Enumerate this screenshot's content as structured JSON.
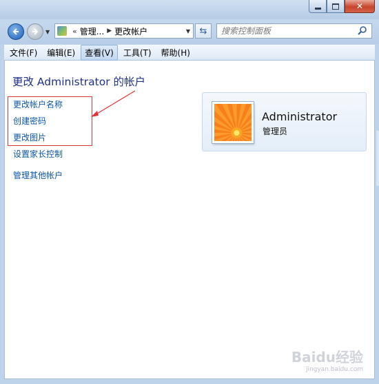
{
  "window": {
    "min_label": "",
    "max_label": "",
    "close_label": "✕"
  },
  "nav": {
    "breadcrumb_overflow": "«",
    "breadcrumb": [
      "管理...",
      "更改帐户"
    ],
    "search_placeholder": "搜索控制面板"
  },
  "menu": {
    "items": [
      "文件(F)",
      "编辑(E)",
      "查看(V)",
      "工具(T)",
      "帮助(H)"
    ],
    "active_index": 2
  },
  "page": {
    "title": "更改 Administrator 的帐户",
    "tasks": [
      "更改帐户名称",
      "创建密码",
      "更改图片",
      "设置家长控制",
      "管理其他帐户"
    ]
  },
  "account": {
    "name": "Administrator",
    "role": "管理员"
  },
  "watermark": {
    "brand": "Baidu经验",
    "url": "jingyan.baidu.com"
  },
  "colors": {
    "link": "#0b57a6",
    "title": "#1e3287",
    "annotation": "#e0323a"
  }
}
